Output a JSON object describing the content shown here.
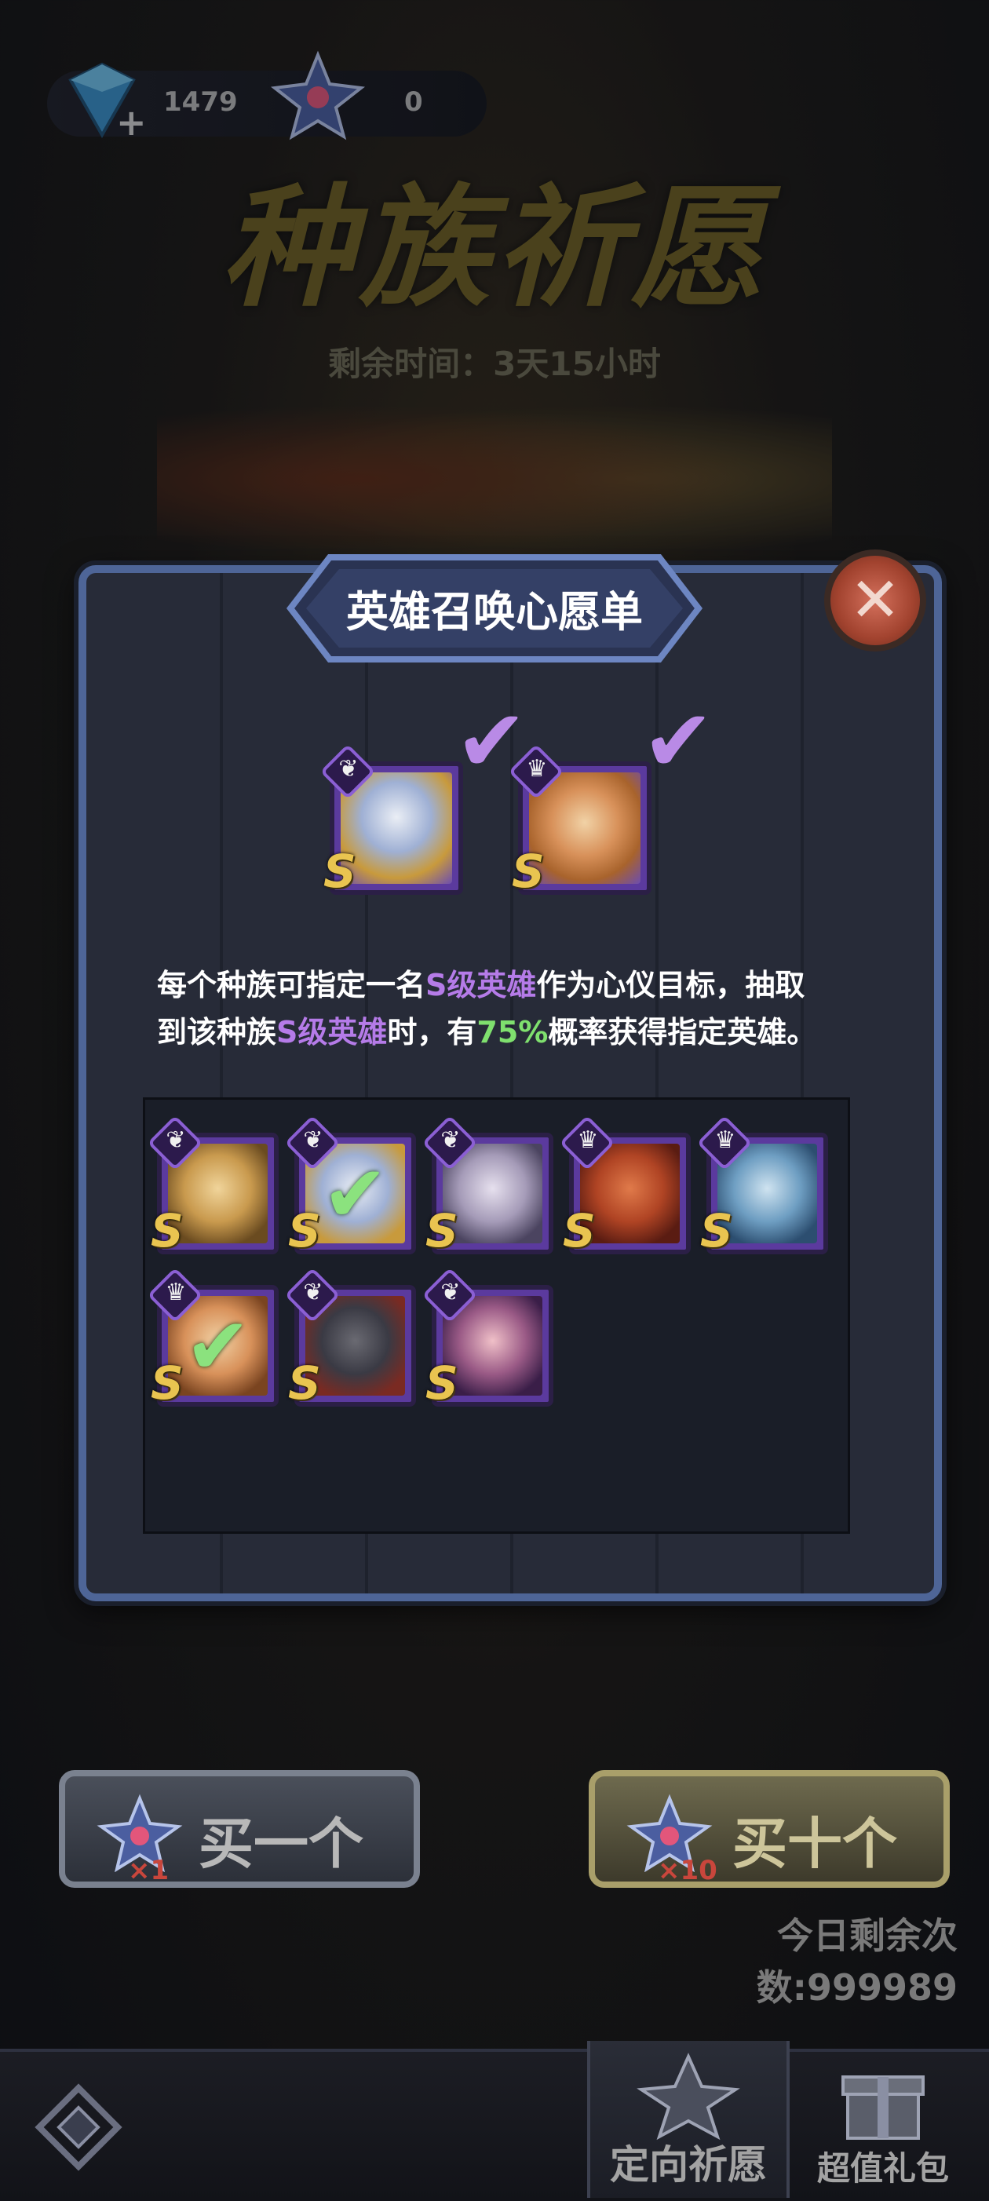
{
  "currency": {
    "gems": "1479",
    "stars": "0"
  },
  "banner": {
    "title": "种族祈愿",
    "remaining": "剩余时间：3天15小时"
  },
  "modal": {
    "title": "英雄召唤心愿单",
    "desc_line1_a": "每个种族可指定一名",
    "desc_line1_b": "S级英雄",
    "desc_line1_c": "作为心仪目标，抽取",
    "desc_line2_a": "到该种族",
    "desc_line2_b": "S级英雄",
    "desc_line2_c": "时，有",
    "desc_line2_d": "75%",
    "desc_line2_e": "概率获得指定英雄。",
    "rank_letter": "S",
    "selected": [
      {
        "race": "wing-icon",
        "portrait": "armored-knight"
      },
      {
        "race": "beast-icon",
        "portrait": "tiger-warrior"
      }
    ],
    "heroes": [
      {
        "race": "wing-icon",
        "portrait": "gold-sage",
        "checked": false
      },
      {
        "race": "wing-icon",
        "portrait": "armored-knight",
        "checked": true
      },
      {
        "race": "wing-icon",
        "portrait": "silver-lady",
        "checked": false
      },
      {
        "race": "beast-icon",
        "portrait": "lion-beast",
        "checked": false
      },
      {
        "race": "beast-icon",
        "portrait": "blue-beast",
        "checked": false
      },
      {
        "race": "beast-icon",
        "portrait": "tiger-warrior",
        "checked": true
      },
      {
        "race": "wing-icon",
        "portrait": "hat-rogue",
        "checked": false
      },
      {
        "race": "wing-icon",
        "portrait": "dark-witch",
        "checked": false
      }
    ],
    "colors": {
      "accent_purple": "#b57be8",
      "accent_green": "#7fe06e"
    }
  },
  "buttons": {
    "buy_one": "买一个",
    "buy_one_count": "×1",
    "buy_ten": "买十个",
    "buy_ten_count": "×10"
  },
  "remaining_today": "今日剩余次数:999989",
  "tabs": {
    "wish": "定向祈愿",
    "gift": "超值礼包"
  }
}
